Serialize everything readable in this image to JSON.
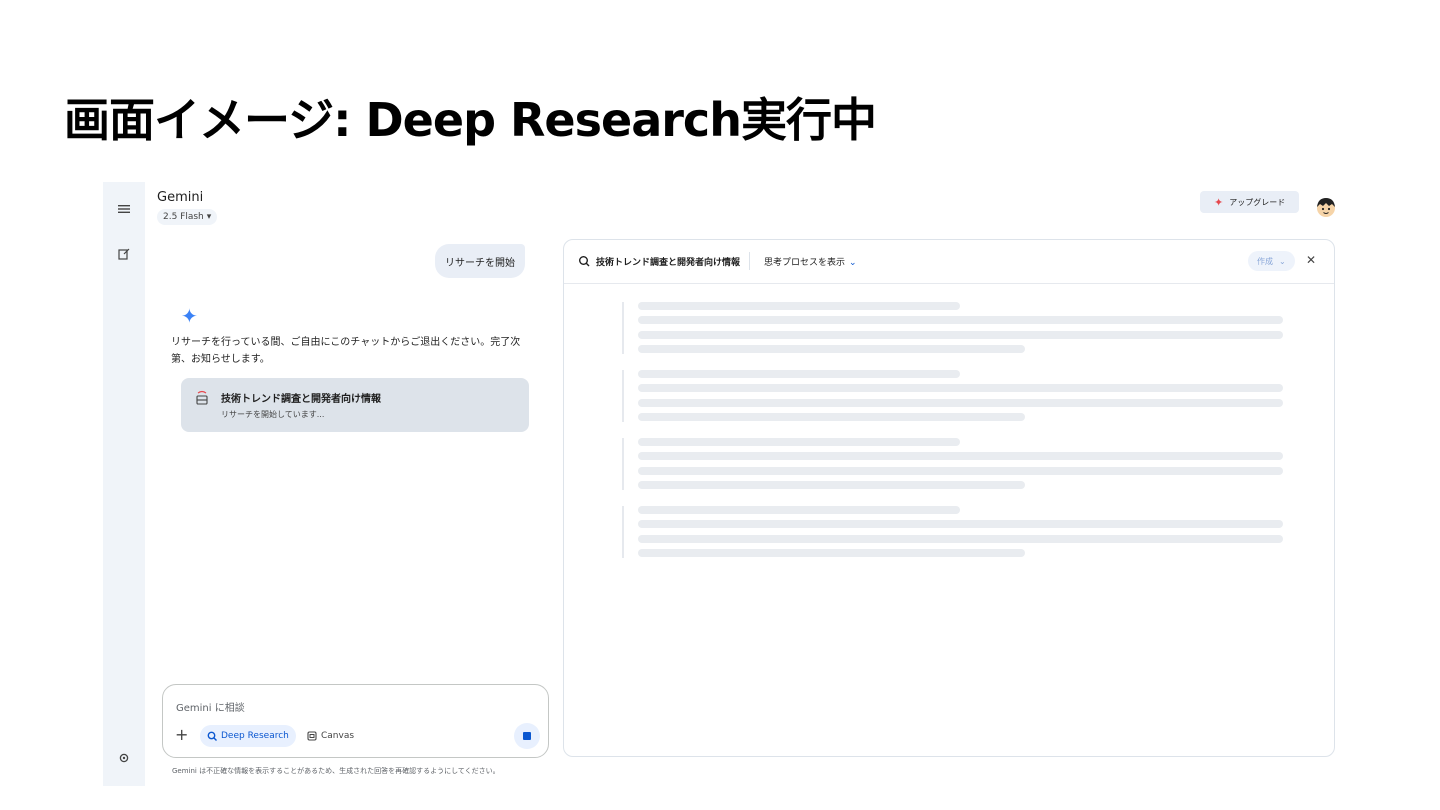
{
  "slide": {
    "title": "画面イメージ: Deep Research実行中"
  },
  "header": {
    "brand": "Gemini",
    "model": "2.5 Flash",
    "upgrade_label": "アップグレード"
  },
  "chat": {
    "user_message": "リサーチを開始",
    "reply": "リサーチを行っている間、ご自由にこのチャットからご退出ください。完了次第、お知らせします。",
    "card_title": "技術トレンド調査と開発者向け情報",
    "card_status": "リサーチを開始しています..."
  },
  "composer": {
    "placeholder": "Gemini に相談",
    "deep_research_label": "Deep Research",
    "canvas_label": "Canvas"
  },
  "disclaimer": "Gemini は不正確な情報を表示することがあるため、生成された回答を再確認するようにしてください。",
  "panel": {
    "title": "技術トレンド調査と開発者向け情報",
    "thought_label": "思考プロセスを表示",
    "create_label": "作成"
  },
  "colors": {
    "accent": "#0b57d0",
    "gemini_star": "#3b82f6",
    "upgrade_star": "#e5484d",
    "rail": "#f0f4f9"
  }
}
